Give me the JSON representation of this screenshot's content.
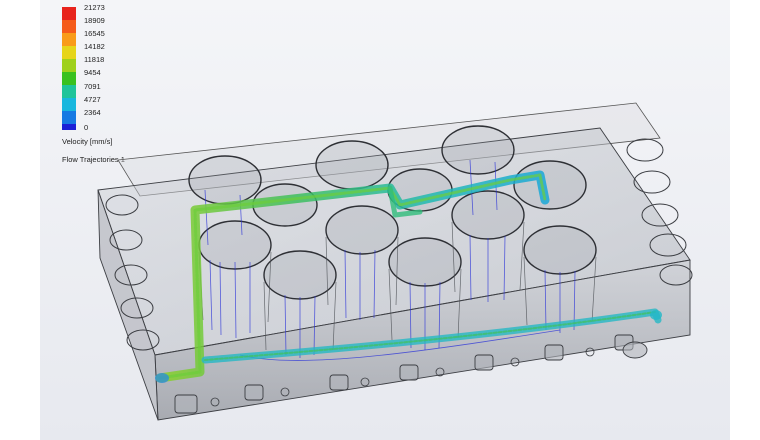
{
  "legend": {
    "ticks": [
      "21273",
      "18909",
      "16545",
      "14182",
      "11818",
      "9454",
      "7091",
      "4727",
      "2364",
      "0"
    ],
    "colors": [
      "#e8231c",
      "#f55b1a",
      "#f99b19",
      "#e6d51a",
      "#9fd11c",
      "#39c11f",
      "#1fc49a",
      "#18b7de",
      "#1679e3",
      "#1a1fd6"
    ],
    "title": "Velocity [mm/s]",
    "plot_name": "Flow Trajectories 1"
  }
}
